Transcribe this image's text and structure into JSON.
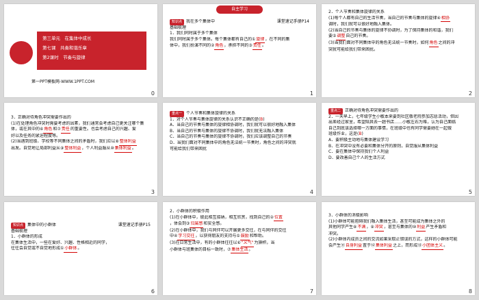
{
  "slides": [
    {
      "num": "0",
      "title_lines": [
        "第三单元　在集体中成长",
        "第七课　共奏和谐乐章",
        "第2课时　节奏与旋律"
      ],
      "footer": "第一PPT模板网-WWW.1PPT.COM"
    },
    {
      "num": "1",
      "banner": "自主学习",
      "tag": "知识点",
      "section": "我在多个集体中",
      "right": "课堂速记手册P14",
      "sub": "基础梳理",
      "l1": "1．我们同时属于多个集体",
      "l2": "我们同时属于多个集体。每个集体都有自己的①",
      "a1": "旋律",
      "l3": "，在不同的集",
      "l4": "体中，我们扮演不同的②",
      "a2": "角色",
      "l5": "，承担不同的③",
      "a3": "责任",
      "l6": "。"
    },
    {
      "num": "2",
      "l1": "2．个人节奏和集体旋律的关系",
      "l2": "(1)每个人都有自己的生活节奏，当自己的节奏与集体的旋律④",
      "a1": "相协",
      "l3": "调时，我们就可以很好地融入集体。",
      "l4": "(2)当自己的节奏与集体的旋律不协调时，为了保持集体的和谐，我们",
      "l5": "要⑤",
      "a2": "调整",
      "l6": "自己的节奏。",
      "l7": "(3)当我们面对不同集体中的角色无法统一节奏时，如何",
      "a3": "角色",
      "l8": "之间的冲",
      "l9": "突就可能给我们带来困扰。"
    },
    {
      "num": "3",
      "l1": "3．正确对待角色冲突需要作出的",
      "l2": "(1)在处理角色冲突时需要考虑的因素，我们通常会考虑自己更关注哪个集",
      "l3": "体，或在其中的⑥",
      "a1": "角色",
      "l4": "和⑦",
      "a2": "责任",
      "l5": "的重要性。也会考虑自己的兴趣、爱",
      "l6": "好以及任务的紧迫程度等。",
      "l7": "(2)当遇到班级、学校等不同集体之间的矛盾时，我们应以⑧",
      "a3": "整体利益",
      "l8": "出发。自觉地让局部利益从⑨",
      "a4": "整体利益",
      "l9": "，个人利益服从⑩",
      "a5": "集体利益",
      "l10": "。"
    },
    {
      "num": "4",
      "tag": "重点一",
      "h1": "个人节奏和集体旋律的关系",
      "q": "1．对个人节奏与集体旋律的关系认识不正确的是(",
      "qa": "B",
      "qe": ")",
      "A": "A．当自己的节奏与集体的旋律相协调时，我们就可以很好地融入集体",
      "B": "B．当自己的节奏与集体的旋律不协调时，我们就无法融入集体",
      "C": "C．当自己的节奏与集体的旋律不协调时，我们应该调整自己的节奏",
      "D": "D．当我们面对不同集体中的角色无法统一节奏时，角色之间的冲突就",
      "D2": "可能给我们带来困扰"
    },
    {
      "num": "5",
      "tag": "重点二",
      "h1": "正确对待角色冲突需要作出的",
      "p1": "2．一天早上，七年级学生小敏本来要到社区敬老院参加志愿活动，但因",
      "p2": "出差经过家里，希望陪其去一趟书店……小敏左右为难，认为自己面临",
      "p3": "自己到底该选择哪一方面的事情，在班级中也有同学需要她在一起做",
      "p4": "班级作业，这是(",
      "pa": "B",
      "pe": ")",
      "A": "A．要积极主动地与集体建设学习",
      "B": "B．在冲突中没有必要和集体分开的原则，自觉服从集体利益",
      "C": "C．要在集体中保持我们个人利益",
      "D": "D．要改善自己个人的生活方式"
    },
    {
      "num": "6",
      "tag": "知识点",
      "section": "集体中的小群体",
      "right": "课堂速记手册P15",
      "sub": "基础梳理",
      "l1": "1．小群体的形成",
      "l2": "在集体生活中，一些在爱好、兴趣、性格相近的同学，",
      "l3": "往往会自觉或不自觉地形成①",
      "a1": "小群体",
      "l4": "。"
    },
    {
      "num": "7",
      "l1": "2．小群体的积极作用",
      "l2": "(1)在小群体中，彼此相互接纳，相互欣赏，找到自己的②",
      "a1": "位置",
      "l3": "，体会到③",
      "a2": "归属感",
      "l4": "和安全感。",
      "l5": "(2)在小群体中，我们与同伴可以开展更多交往，在与同伴的交往",
      "l6": "中④",
      "a3": "学习交往",
      "l7": "，以获得朋友的支持与⑤",
      "a4": "鼓励",
      "l8": "和帮助。",
      "l9": "(3)在日常生活中，有的小群体往往以⑥",
      "a5": "\"义气\"",
      "l10": "为旗帜，当",
      "l11": "小群体与班集体的目标一致时，⑦",
      "a6": "集体生活",
      "l12": "。"
    },
    {
      "num": "8",
      "l1": "3．小群体的消极影响",
      "l2": "(1)小群体可能阻碍我们融入集体生活，甚至可能成为集体之外的",
      "l3": "其他同学产生⑧",
      "a1": "不满",
      "l4": "，⑨",
      "a2": "冲突",
      "l5": "，甚至与集体的⑩",
      "a3": "利益",
      "l6": "产生矛盾和",
      "l7": "冲突。",
      "l8": "(2)小群体内成员之间的交流如果采取止错误的方式，这样的小群体可能",
      "l9": "会产生⑪",
      "a4": "自身利益",
      "l10": "置于⑫",
      "a5": "集体利益",
      "l11": "之上，而形成⑬",
      "a6": "小团体主义",
      "l12": "。"
    }
  ]
}
